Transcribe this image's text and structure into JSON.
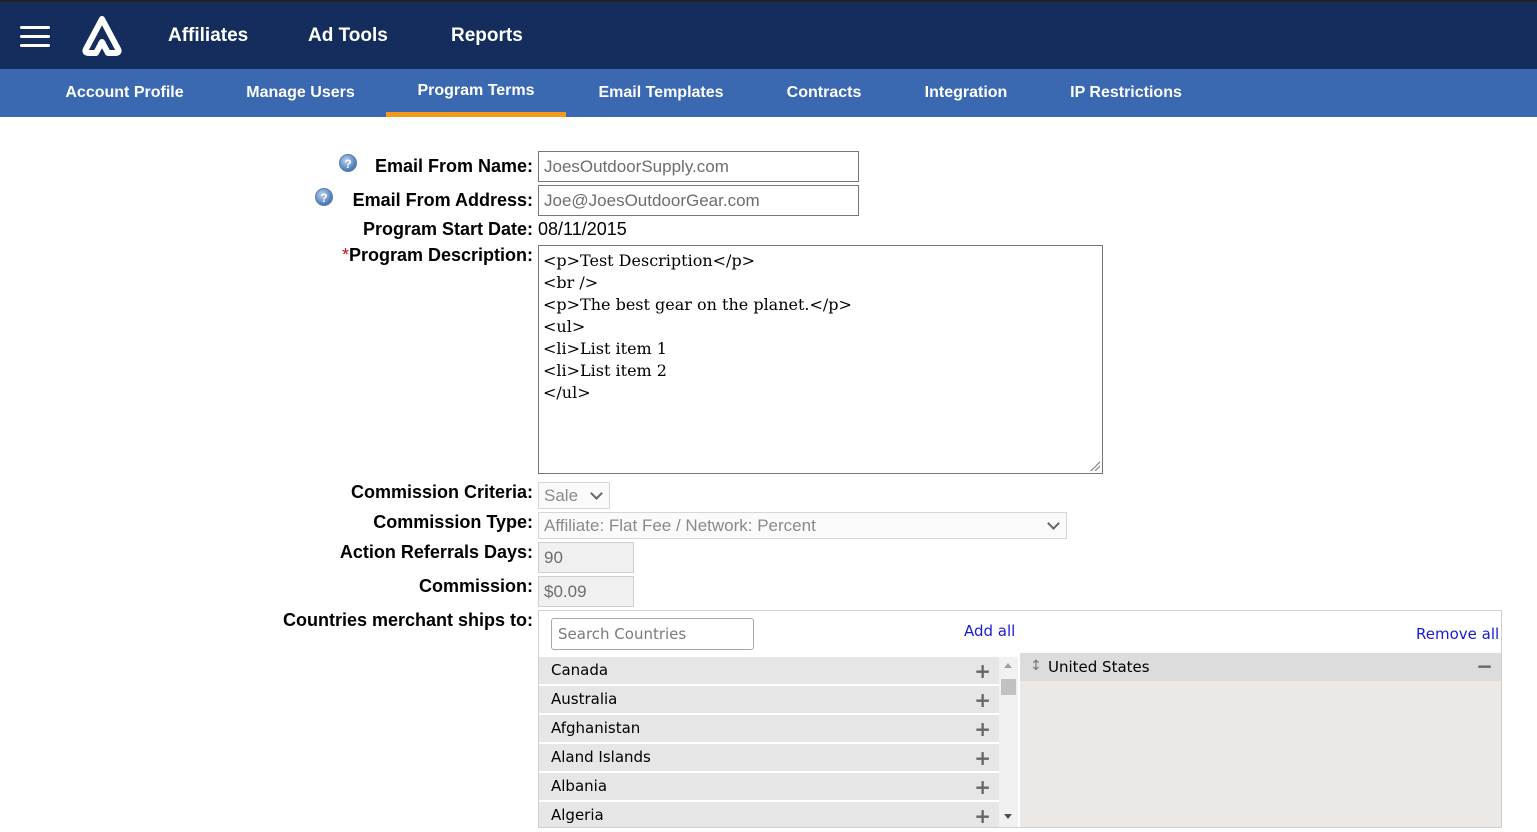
{
  "topbar": {
    "nav": [
      "Affiliates",
      "Ad Tools",
      "Reports"
    ]
  },
  "subnav": {
    "tabs": [
      "Account Profile",
      "Manage Users",
      "Program Terms",
      "Email Templates",
      "Contracts",
      "Integration",
      "IP Restrictions"
    ],
    "active": "Program Terms"
  },
  "form": {
    "email_from_name": {
      "label": "Email From Name:",
      "value": "JoesOutdoorSupply.com"
    },
    "email_from_address": {
      "label": "Email From Address:",
      "value": "Joe@JoesOutdoorGear.com"
    },
    "program_start_date": {
      "label": "Program Start Date:",
      "value": "08/11/2015"
    },
    "program_description": {
      "required_mark": "*",
      "label": "Program Description:",
      "value": "<p>Test Description</p>\n<br />\n<p>The best gear on the planet.</p>\n<ul>\n<li>List item 1\n<li>List item 2\n</ul>"
    },
    "commission_criteria": {
      "label": "Commission Criteria:",
      "value": "Sale"
    },
    "commission_type": {
      "label": "Commission Type:",
      "value": "Affiliate: Flat Fee / Network: Percent"
    },
    "action_referrals_days": {
      "label": "Action Referrals Days:",
      "value": "90"
    },
    "commission": {
      "label": "Commission:",
      "value": "$0.09"
    },
    "countries": {
      "label": "Countries merchant ships to:",
      "search_placeholder": "Search Countries",
      "add_all": "Add all",
      "remove_all": "Remove all",
      "available": [
        "Canada",
        "Australia",
        "Afghanistan",
        "Aland Islands",
        "Albania",
        "Algeria"
      ],
      "selected": [
        "United States"
      ]
    }
  }
}
